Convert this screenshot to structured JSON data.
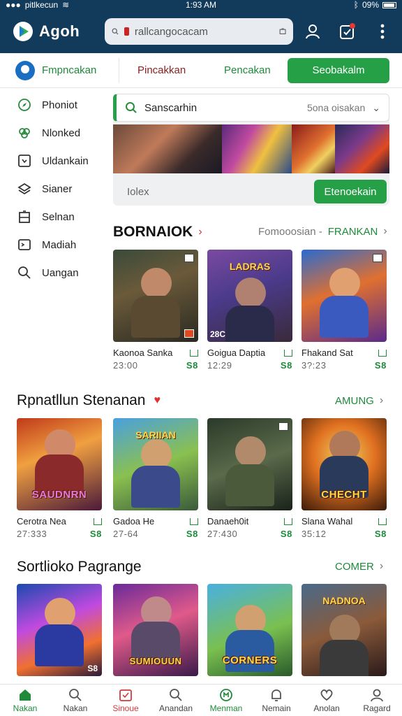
{
  "status_bar": {
    "carrier": "pitlkecun",
    "time": "1:93 AM",
    "battery": "09%"
  },
  "header": {
    "app_name": "Agoh",
    "search_value": "rallcangocacam"
  },
  "tabs": {
    "first": "Fmpncakan",
    "second": "Pincakkan",
    "third": "Pencakan",
    "cta": "Seobakalm"
  },
  "sidebar": {
    "items": [
      {
        "label": "Phoniot",
        "icon": "compass-icon"
      },
      {
        "label": "Nlonked",
        "icon": "clover-icon"
      },
      {
        "label": "Uldankain",
        "icon": "tablet-icon"
      },
      {
        "label": "Sianer",
        "icon": "layers-icon"
      },
      {
        "label": "Selnan",
        "icon": "cabinet-icon"
      },
      {
        "label": "Madiah",
        "icon": "terminal-icon"
      },
      {
        "label": "Uangan",
        "icon": "search-icon"
      }
    ]
  },
  "promo": {
    "search_label": "Sanscarhin",
    "search_hint": "5ona oisakan",
    "bottom_text": "Iolex",
    "button": "Etenoekain"
  },
  "section1": {
    "title": "BORNAIOK",
    "link_grey": "Fomooosian -",
    "link_green": "FRANKAN",
    "cards": [
      {
        "title": "Kaonoa Sanka",
        "meta": "23:00",
        "price": "S8",
        "overlay": ""
      },
      {
        "title": "Goigua Daptia",
        "meta": "12:29",
        "price": "S8",
        "overlay": "LADRAS",
        "badge": "28C"
      },
      {
        "title": "Fhakand Sat",
        "meta": "3?:23",
        "price": "S8",
        "overlay": ""
      }
    ]
  },
  "section2": {
    "title": "Rpnatllun Stenanan",
    "link": "AMUNG",
    "cards": [
      {
        "title": "Cerotra Nea",
        "meta": "27:333",
        "price": "S8",
        "overlay": "SAUDNRN"
      },
      {
        "title": "Gadoa He",
        "meta": "27-64",
        "price": "S8",
        "overlay": "SARIIAN"
      },
      {
        "title": "Danaeh0it",
        "meta": "27:430",
        "price": "S8",
        "overlay": ""
      },
      {
        "title": "Slana Wahal",
        "meta": "35:12",
        "price": "S8",
        "overlay": "CHECHT"
      }
    ]
  },
  "section3": {
    "title": "Sortlioko Pagrange",
    "link": "COMER",
    "cards": [
      {
        "title": "",
        "overlay": "",
        "badge": "S8"
      },
      {
        "title": "",
        "overlay": "SUMIOUUN"
      },
      {
        "title": "",
        "overlay": "CORNERS"
      },
      {
        "title": "",
        "overlay": "NADNOA"
      }
    ]
  },
  "bottom_nav": [
    {
      "label": "Nakan",
      "icon": "home-icon",
      "state": "active"
    },
    {
      "label": "Nakan",
      "icon": "search-icon",
      "state": ""
    },
    {
      "label": "Sinoue",
      "icon": "calendar-icon",
      "state": "red"
    },
    {
      "label": "Anandan",
      "icon": "search-icon",
      "state": ""
    },
    {
      "label": "Menman",
      "icon": "medal-icon",
      "state": "active"
    },
    {
      "label": "Nemain",
      "icon": "bell-icon",
      "state": ""
    },
    {
      "label": "Anolan",
      "icon": "heart-icon",
      "state": ""
    },
    {
      "label": "Ragard",
      "icon": "user-icon",
      "state": ""
    }
  ],
  "colors": {
    "header_bg": "#123a5a",
    "accent_green": "#26a047",
    "link_green": "#1e8a3a"
  }
}
